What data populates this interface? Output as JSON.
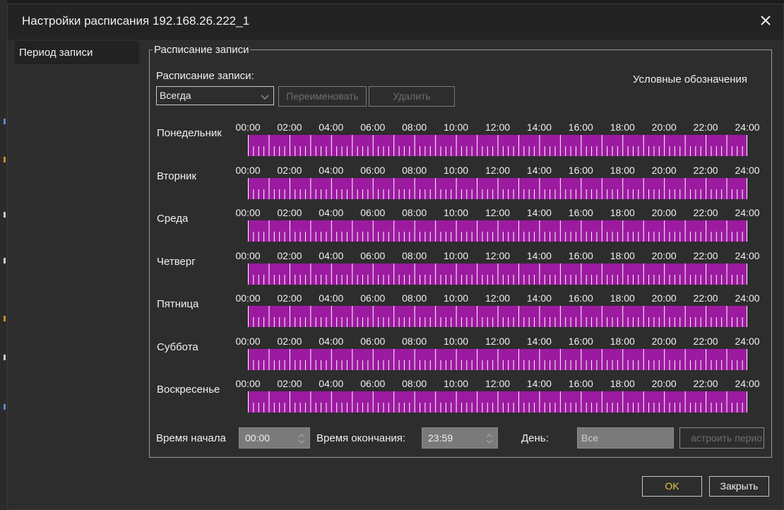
{
  "dialog": {
    "title": "Настройки расписания 192.168.26.222_1",
    "close_icon": "close-icon"
  },
  "sidebar": {
    "items": [
      {
        "label": "Период записи"
      }
    ]
  },
  "group": {
    "title": "Расписание записи",
    "schedule_label": "Расписание записи:",
    "legend_link": "Условные обозначения",
    "schedule_select": {
      "value": "Всегда",
      "icon": "chevron-down-icon"
    },
    "rename_button": "Переименовать",
    "delete_button": "Удалить"
  },
  "timeline": {
    "ticks": [
      "00:00",
      "02:00",
      "04:00",
      "06:00",
      "08:00",
      "10:00",
      "12:00",
      "14:00",
      "16:00",
      "18:00",
      "20:00",
      "22:00",
      "24:00"
    ],
    "fill_color": "#9c1aa0",
    "days": [
      {
        "label": "Понедельник",
        "coverage": 1.0
      },
      {
        "label": "Вторник",
        "coverage": 1.0
      },
      {
        "label": "Среда",
        "coverage": 1.0
      },
      {
        "label": "Четверг",
        "coverage": 1.0
      },
      {
        "label": "Пятница",
        "coverage": 1.0
      },
      {
        "label": "Суббота",
        "coverage": 1.0
      },
      {
        "label": "Воскресенье",
        "coverage": 1.0
      }
    ]
  },
  "footer": {
    "start_label": "Время начала",
    "start_value": "00:00",
    "end_label": "Время окончания:",
    "end_value": "23:59",
    "day_label": "День:",
    "day_value": "Все",
    "copy_button": "астроить перио"
  },
  "buttons": {
    "ok": "OK",
    "close": "Закрыть"
  },
  "colors": {
    "accent_ok": "#e8c440",
    "dialog_bg": "#2d2d2d",
    "titlebar_bg": "#232323"
  }
}
